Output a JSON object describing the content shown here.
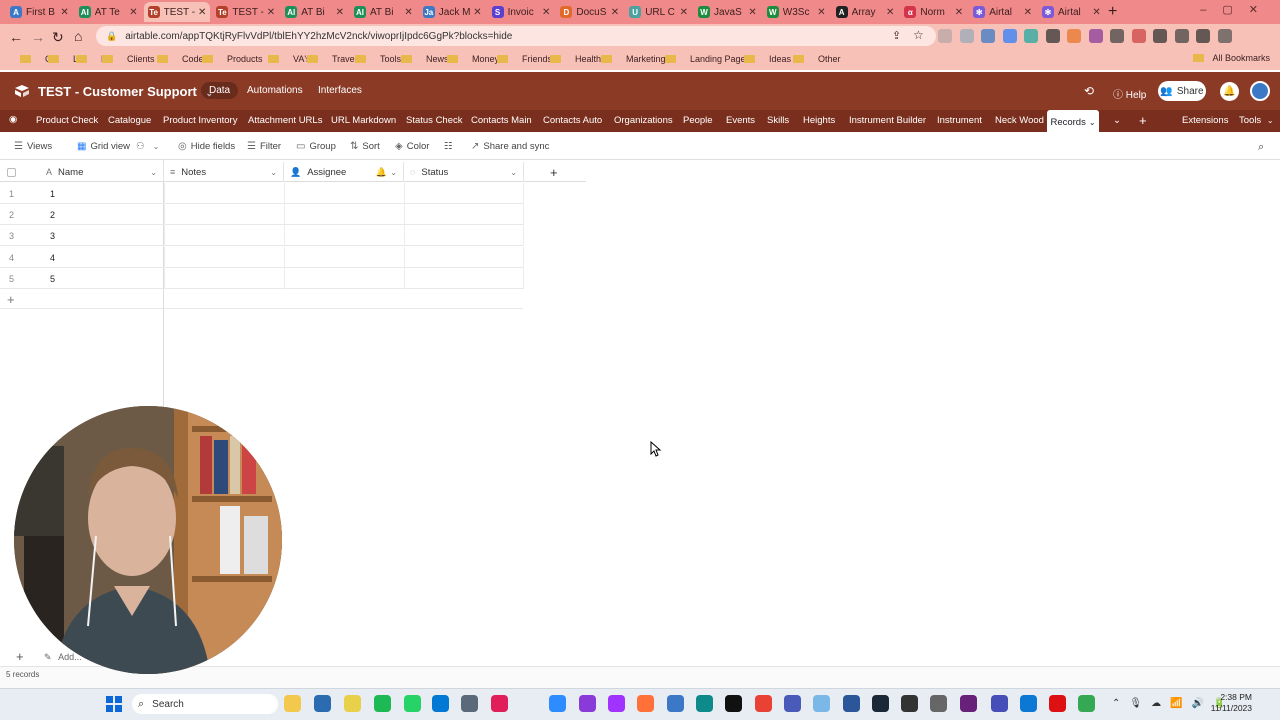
{
  "browser": {
    "tabs": [
      {
        "label": "First B",
        "color": "#3b79c7",
        "glyph": "A"
      },
      {
        "label": "AT Te",
        "color": "#1e8f5a",
        "glyph": "AI"
      },
      {
        "label": "TEST -",
        "color": "#b2402a",
        "glyph": "Te",
        "active": true
      },
      {
        "label": "TEST -",
        "color": "#b2402a",
        "glyph": "Te"
      },
      {
        "label": "AT Bi",
        "color": "#1e8f5a",
        "glyph": "AI"
      },
      {
        "label": "AT Bi",
        "color": "#1e8f5a",
        "glyph": "AI"
      },
      {
        "label": "Jack M",
        "color": "#3b79c7",
        "glyph": "Ja"
      },
      {
        "label": "Invoic",
        "color": "#5b3fd1",
        "glyph": "S"
      },
      {
        "label": "DocuS",
        "color": "#e06a2a",
        "glyph": "D"
      },
      {
        "label": "URL C",
        "color": "#4aa3a0",
        "glyph": "U"
      },
      {
        "label": "JavaS",
        "color": "#1b8d3d",
        "glyph": "W"
      },
      {
        "label": "W3Sc",
        "color": "#1b8d3d",
        "glyph": "W"
      },
      {
        "label": "Array",
        "color": "#222222",
        "glyph": "A"
      },
      {
        "label": "Norm",
        "color": "#d4334a",
        "glyph": "α"
      },
      {
        "label": "Airtal",
        "color": "#7a5ad8",
        "glyph": "✻"
      },
      {
        "label": "Airtal",
        "color": "#7a5ad8",
        "glyph": "✻"
      }
    ],
    "url": "airtable.com/appTQKtjRyFlvVdPl/tblEhYY2hzMcV2nck/viwoprIjIpdc6GgPk?blocks=hide",
    "bookmarks": [
      "G",
      "L",
      "F",
      "Clients",
      "Code",
      "Products",
      "VA's",
      "Travel",
      "Tools",
      "News",
      "Money",
      "Friends",
      "Health",
      "Marketing",
      "Landing Pages",
      "Ideas",
      "Other"
    ],
    "all_bookmarks": "All Bookmarks"
  },
  "app": {
    "base_name": "TEST - Customer Support",
    "nav": [
      "Data",
      "Automations",
      "Interfaces"
    ],
    "help": "Help",
    "share": "Share",
    "tables": [
      "Product Check",
      "Catalogue",
      "Product Inventory",
      "Attachment URLs",
      "URL Markdown",
      "Status Check",
      "Contacts Main",
      "Contacts Auto",
      "Organizations",
      "People",
      "Events",
      "Skills",
      "Heights",
      "Instrument Builder",
      "Instrument",
      "Neck Wood"
    ],
    "active_table": "Records",
    "extensions": "Extensions",
    "tools": "Tools"
  },
  "toolbar": {
    "views": "Views",
    "grid_view": "Grid view",
    "hide_fields": "Hide fields",
    "filter": "Filter",
    "group": "Group",
    "sort": "Sort",
    "color": "Color",
    "share_sync": "Share and sync"
  },
  "grid": {
    "columns": [
      "Name",
      "Notes",
      "Assignee",
      "Status"
    ],
    "rows": [
      {
        "num": "1",
        "name": "1"
      },
      {
        "num": "2",
        "name": "2"
      },
      {
        "num": "3",
        "name": "3"
      },
      {
        "num": "4",
        "name": "4"
      },
      {
        "num": "5",
        "name": "5"
      }
    ],
    "record_count": "5 records",
    "add_label": "Add..."
  },
  "taskbar": {
    "search": "Search",
    "time": "2:38 PM",
    "date": "11/11/2023"
  }
}
